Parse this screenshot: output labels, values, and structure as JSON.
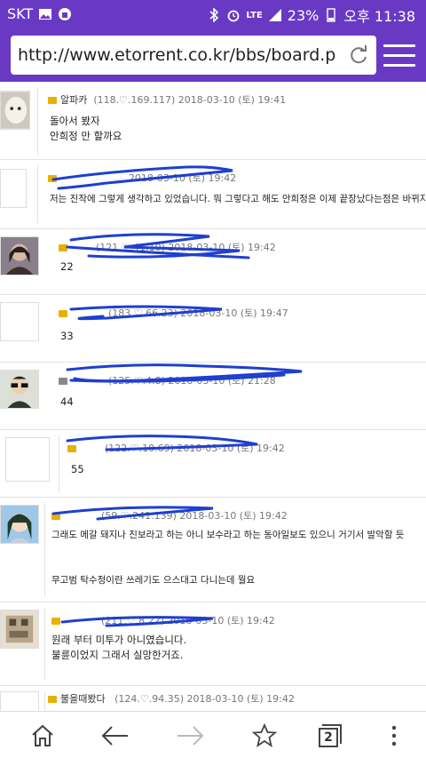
{
  "status": {
    "carrier": "SKT",
    "net": "LTE",
    "battery": "23%",
    "time": "오후 11:38"
  },
  "browser": {
    "url": "http://www.etorrent.co.kr/bbs/board.php?...",
    "tab_count": "2"
  },
  "comments": [
    {
      "nick": "알파카",
      "meta": "(118.♡.169.117) 2018-03-10 (토) 19:41",
      "lines": [
        "돌아서 봤자",
        "안희정 만 할까요"
      ]
    },
    {
      "nick": "",
      "meta": "2018-03-10 (토) 19:42",
      "lines": [
        "저는 진작에 그렇게 생각하고 있었습니다. 뭐 그렇다고 해도 안희정은 이제 끝장났다는점은 바뀌지 않지만요"
      ]
    },
    {
      "nick": "",
      "meta": "(121.♡.41.10) 2018-03-10 (토) 19:42",
      "lines": [
        "22"
      ]
    },
    {
      "nick": "",
      "meta": "(183.♡.66.23) 2018-03-10 (토) 19:47",
      "lines": [
        "33"
      ]
    },
    {
      "nick": "",
      "meta": "(125.♡.4.8) 2018-03-10 (토) 21:28",
      "lines": [
        "44"
      ]
    },
    {
      "nick": "",
      "meta": "(122.♡.10.69) 2018-03-10 (토) 19:42",
      "lines": [
        "55"
      ]
    },
    {
      "nick": "",
      "meta": "(59.♡.241.139) 2018-03-10 (토) 19:42",
      "lines": [
        "그래도 메갈 돼지나 진보라고 하는 아니 보수라고 하는 동아일보도 있으니 거기서 발악할 듯",
        "",
        "",
        "무고범 탁수정이란 쓰레기도 으스대고 다니는데 뭘요"
      ]
    },
    {
      "nick": "",
      "meta": "(211.♡.8.22) 2018-03-10 (토) 19:42",
      "lines": [
        "원래 부터 미투가 아니였습니다.",
        "불륜이었지 그래서 실망한거죠."
      ]
    },
    {
      "nick": "불을때봤다",
      "meta": "(124.♡.94.35) 2018-03-10 (토) 19:42",
      "lines": []
    }
  ],
  "colors": {
    "accent": "#6a39c4",
    "scribble": "#1e3fd0"
  }
}
